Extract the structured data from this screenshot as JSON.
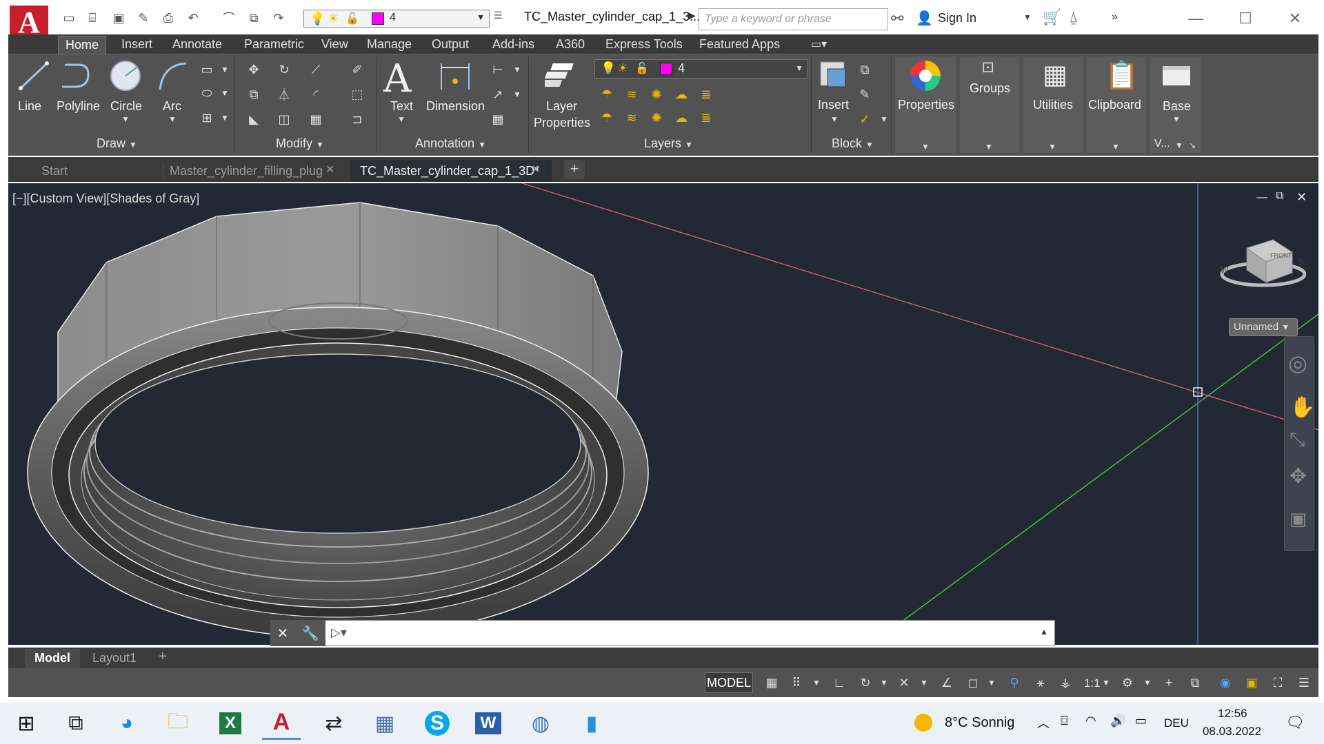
{
  "app": {
    "file_title": "TC_Master_cylinder_cap_1_3...",
    "search_placeholder": "Type a keyword or phrase",
    "sign_in": "Sign In",
    "layer_value": "4",
    "accent_color": "#c8202a",
    "layer_color": "#ff00ff"
  },
  "menu": [
    "Home",
    "Insert",
    "Annotate",
    "Parametric",
    "View",
    "Manage",
    "Output",
    "Add-ins",
    "A360",
    "Express Tools",
    "Featured Apps"
  ],
  "ribbon": {
    "draw": {
      "line": "Line",
      "polyline": "Polyline",
      "circle": "Circle",
      "arc": "Arc",
      "title": "Draw"
    },
    "modify": {
      "title": "Modify"
    },
    "annotation": {
      "text": "Text",
      "dimension": "Dimension",
      "title": "Annotation"
    },
    "layers": {
      "layer_line1": "Layer",
      "layer_line2": "Properties",
      "title": "Layers",
      "current": "4"
    },
    "block": {
      "insert": "Insert",
      "title": "Block"
    },
    "properties": "Properties",
    "groups": "Groups",
    "utilities": "Utilities",
    "clipboard": "Clipboard",
    "base": "Base",
    "view_short": "V..."
  },
  "doc_tabs": [
    "Start",
    "Master_cylinder_filling_plug",
    "TC_Master_cylinder_cap_1_3D*"
  ],
  "viewport": {
    "label": "[−][Custom View][Shades of Gray]",
    "view_name": "Unnamed",
    "cube_face": "FRONT"
  },
  "layout_tabs": [
    "Model",
    "Layout1"
  ],
  "status": {
    "model": "MODEL",
    "scale": "1:1"
  },
  "taskbar": {
    "weather": "8°C  Sonnig",
    "lang": "DEU",
    "time": "12:56",
    "date": "08.03.2022"
  }
}
